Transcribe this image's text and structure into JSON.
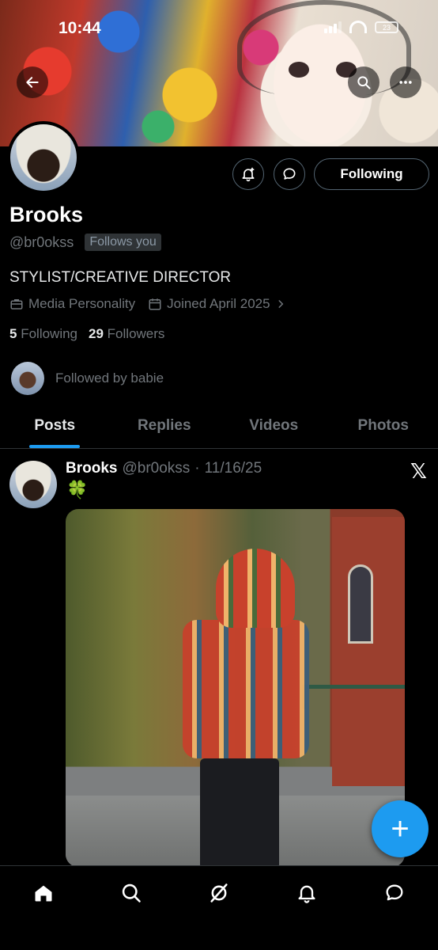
{
  "status_bar": {
    "time": "10:44",
    "battery": "23"
  },
  "profile": {
    "name": "Brooks",
    "handle": "@br0okss",
    "follows_you": "Follows you",
    "bio": "STYLIST/CREATIVE DIRECTOR",
    "category": "Media Personality",
    "joined": "Joined April 2025",
    "following_count": "5",
    "following_label": "Following",
    "followers_count": "29",
    "followers_label": "Followers",
    "followed_by": "Followed by babie",
    "follow_button": "Following"
  },
  "tabs": [
    "Posts",
    "Replies",
    "Videos",
    "Photos"
  ],
  "active_tab": "Posts",
  "post": {
    "author": "Brooks",
    "handle": "@br0okss",
    "separator": "·",
    "date": "11/16/25",
    "text": "🍀"
  },
  "fab_label": "+",
  "colors": {
    "accent": "#1d9bf0",
    "background": "#000000",
    "muted": "#71767b"
  },
  "icons": [
    "back-arrow-icon",
    "search-icon",
    "more-icon",
    "notify-bell-icon",
    "message-icon",
    "briefcase-icon",
    "calendar-icon",
    "chevron-right-icon",
    "x-logo-icon",
    "home-icon",
    "grok-icon",
    "bell-icon",
    "chat-icon"
  ]
}
